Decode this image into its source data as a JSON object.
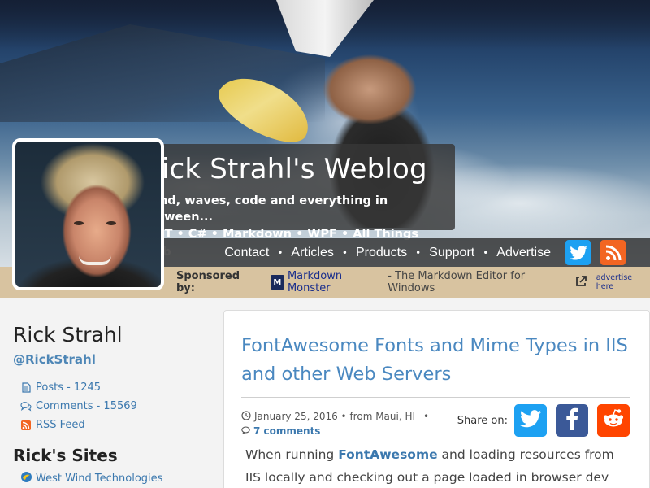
{
  "site": {
    "title": "Rick Strahl's Weblog",
    "tagline": "Wind, waves, code and everything in between...",
    "topics": ".NET • C# • Markdown • WPF • All Things Web"
  },
  "nav": {
    "items": [
      "Contact",
      "Articles",
      "Products",
      "Support",
      "Advertise"
    ],
    "separator": "•",
    "social": [
      "twitter-icon",
      "rss-icon"
    ]
  },
  "sponsor": {
    "label": "Sponsored by:",
    "product": "Markdown Monster",
    "description": "- The Markdown Editor for Windows",
    "advertise": "advertise here"
  },
  "sidebar": {
    "author": "Rick Strahl",
    "handle": "@RickStrahl",
    "stats": [
      {
        "icon": "file-icon",
        "label": "Posts - 1245"
      },
      {
        "icon": "comments-icon",
        "label": "Comments - 15569"
      },
      {
        "icon": "rss-icon",
        "label": "RSS Feed"
      }
    ],
    "sites_title": "Rick's Sites",
    "sites": [
      {
        "icon": "west-wind-icon",
        "label": "West Wind Technologies"
      }
    ]
  },
  "article": {
    "title": "FontAwesome Fonts and Mime Types in IIS and other Web Servers",
    "date": "January 25, 2016 • from Maui, HI",
    "bullet": "•",
    "comments": "7 comments",
    "share_label": "Share on:",
    "share": [
      "twitter-icon",
      "facebook-icon",
      "reddit-icon"
    ],
    "body_pre": "When running ",
    "body_highlight": "FontAwesome",
    "body_post": " and loading resources from IIS locally and checking out a page loaded in browser dev tools"
  },
  "colors": {
    "link": "#3b78ae",
    "title_link": "#4a88c0",
    "sponsor_bar": "#d8c3a0",
    "twitter": "#1da1f2",
    "facebook": "#3b5998",
    "reddit": "#ff4500",
    "rss": "#f26522"
  }
}
